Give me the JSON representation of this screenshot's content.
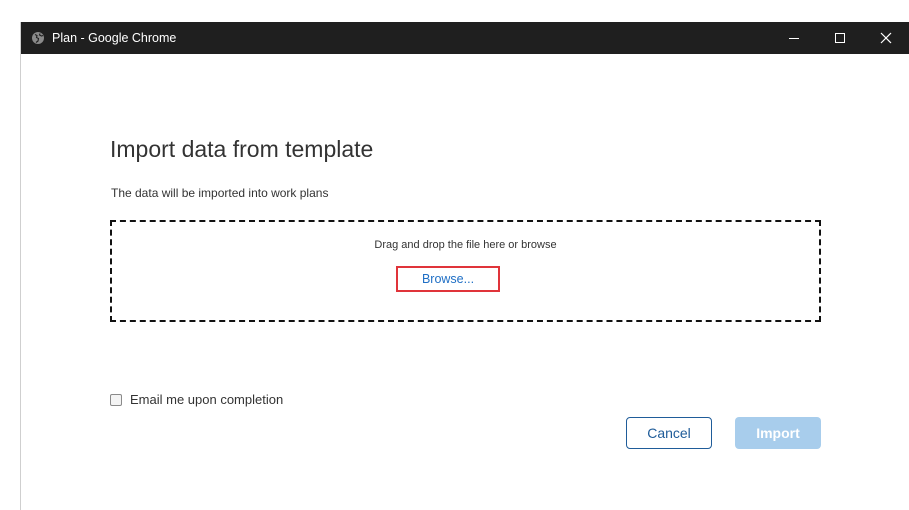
{
  "window": {
    "title": "Plan - Google Chrome",
    "icon": "globe-icon",
    "controls": [
      "minimize-icon",
      "maximize-icon",
      "close-icon"
    ]
  },
  "dialog": {
    "heading": "Import data from template",
    "subtext": "The data will be imported into work plans",
    "dropzone": {
      "hint": "Drag and drop the file here or browse",
      "browse_label": "Browse..."
    },
    "email_checkbox": {
      "label": "Email me upon completion",
      "checked": false
    },
    "buttons": {
      "cancel_label": "Cancel",
      "import_label": "Import"
    }
  },
  "colors": {
    "titlebar": "#1f1f1f",
    "primary": "#1f5c99",
    "link": "#1f6fc5",
    "import_disabled": "#a8cdec",
    "highlight_border": "#e0343a"
  }
}
